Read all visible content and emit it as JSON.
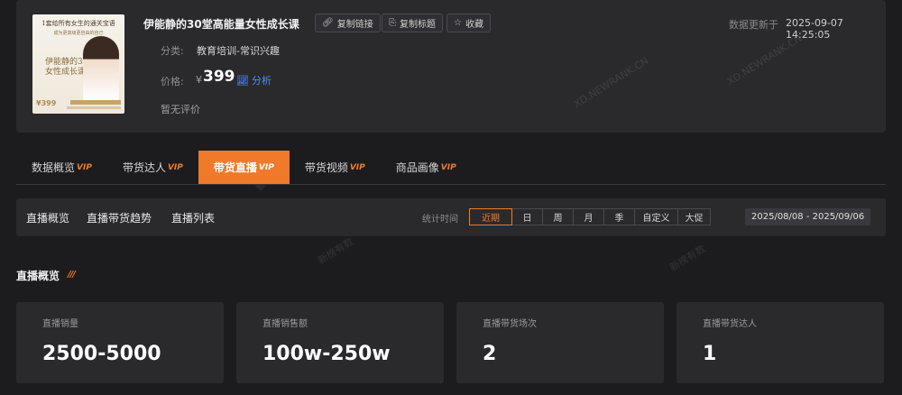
{
  "product": {
    "thumbnail": {
      "line1": "1套给所有女生的通关宝语",
      "line2": "成为更高级更自由的自己",
      "big_text": "伊能静的30堂\n女性成长课",
      "price": "¥399"
    },
    "title": "伊能静的30堂高能量女性成长课",
    "buttons": {
      "copy_link": "复制链接",
      "copy_title": "复制标题",
      "favorite": "收藏"
    },
    "category_label": "分类:",
    "category_value": "教育培训-常识兴趣",
    "price_label": "价格:",
    "currency": "¥",
    "price": "399",
    "analysis": "分析",
    "review": "暂无评价",
    "update_label": "数据更新于",
    "update_time": "2025-09-07 14:25:05"
  },
  "watermarks": [
    "XD.NEWRANK.CN",
    "XD.NEWRANK.CN",
    "新榜有数",
    "新榜有数",
    "新榜有数",
    "新榜有数"
  ],
  "tabs": [
    {
      "label": "数据概览",
      "vip": "VIP"
    },
    {
      "label": "带货达人",
      "vip": "VIP"
    },
    {
      "label": "带货直播",
      "vip": "VIP"
    },
    {
      "label": "带货视频",
      "vip": "VIP"
    },
    {
      "label": "商品画像",
      "vip": "VIP"
    }
  ],
  "subnav": {
    "items": [
      "直播概览",
      "直播带货趋势",
      "直播列表"
    ],
    "stat_label": "统计时间",
    "periods": [
      "近期",
      "日",
      "周",
      "月",
      "季",
      "自定义",
      "大促"
    ],
    "date_range": "2025/08/08 - 2025/09/06"
  },
  "overview": {
    "title": "直播概览",
    "deco": "///",
    "cards": [
      {
        "label": "直播销量",
        "value": "2500-5000"
      },
      {
        "label": "直播销售额",
        "value": "100w-250w"
      },
      {
        "label": "直播带货场次",
        "value": "2"
      },
      {
        "label": "直播带货达人",
        "value": "1"
      }
    ]
  },
  "colors": {
    "accent": "#ef7a29",
    "link": "#4d8cf5",
    "panel": "#2a2a2d",
    "background": "#1c1c1e"
  }
}
